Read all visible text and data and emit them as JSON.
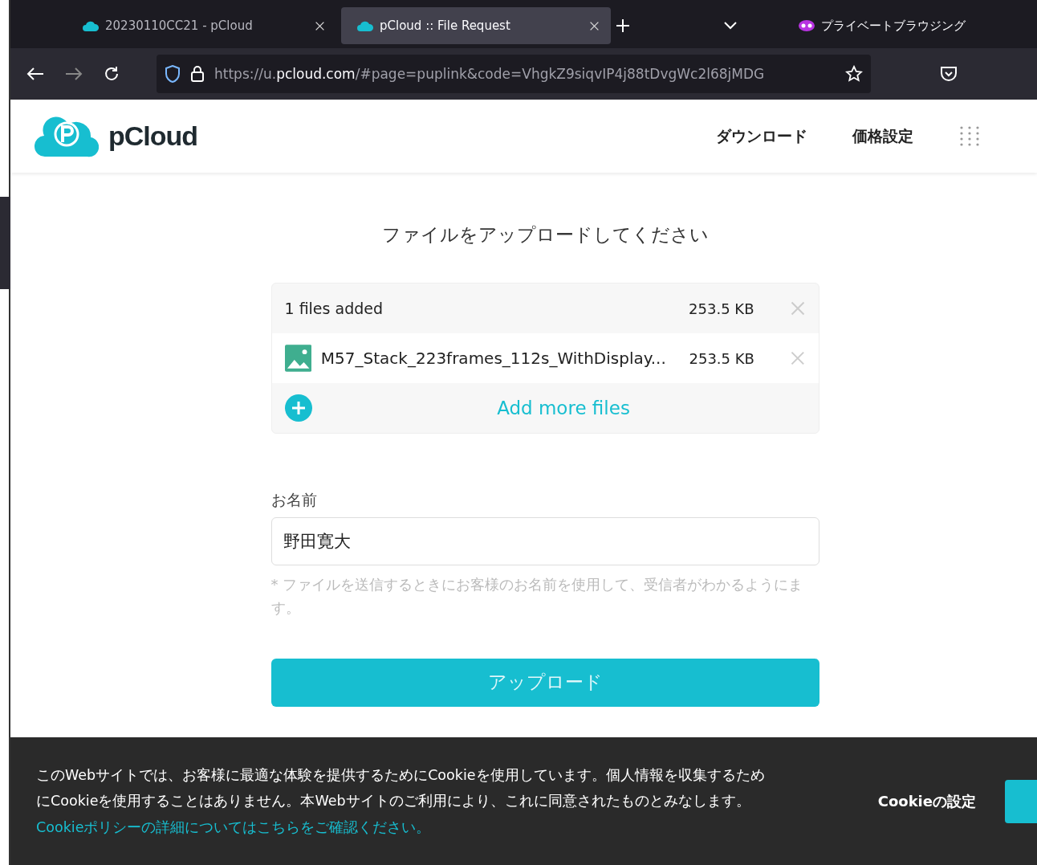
{
  "browser": {
    "tabs": [
      {
        "title": "20230110CC21 - pCloud",
        "selected": false
      },
      {
        "title": "pCloud :: File Request",
        "selected": true
      }
    ],
    "private_label": "プライベートブラウジング",
    "url": {
      "prefix": "https://u.",
      "domain": "pcloud.com",
      "path": "/#page=puplink&code=VhgkZ9siqvIP4j88tDvgWc2l68jMDG"
    }
  },
  "header": {
    "logo_text": "pCloud",
    "nav": [
      "ダウンロード",
      "価格設定"
    ]
  },
  "upload": {
    "title": "ファイルをアップロードしてください",
    "summary": {
      "label": "1 files added",
      "size": "253.5 KB"
    },
    "files": [
      {
        "name": "M57_Stack_223frames_112s_WithDisplay...",
        "size": "253.5 KB"
      }
    ],
    "add_more": "Add more files"
  },
  "name_field": {
    "label": "お名前",
    "value": "野田寛大",
    "hint": "* ファイルを送信するときにお客様のお名前を使用して、受信者がわかるようにます。"
  },
  "submit": "アップロード",
  "cookie": {
    "text": "このWebサイトでは、お客様に最適な体験を提供するためにCookieを使用しています。個人情報を収集するためにCookieを使用することはありません。本Webサイトのご利用により、これに同意されたものとみなします。",
    "link": "Cookieポリシーの詳細についてはこちらをご確認ください。",
    "settings": "Cookieの設定"
  }
}
